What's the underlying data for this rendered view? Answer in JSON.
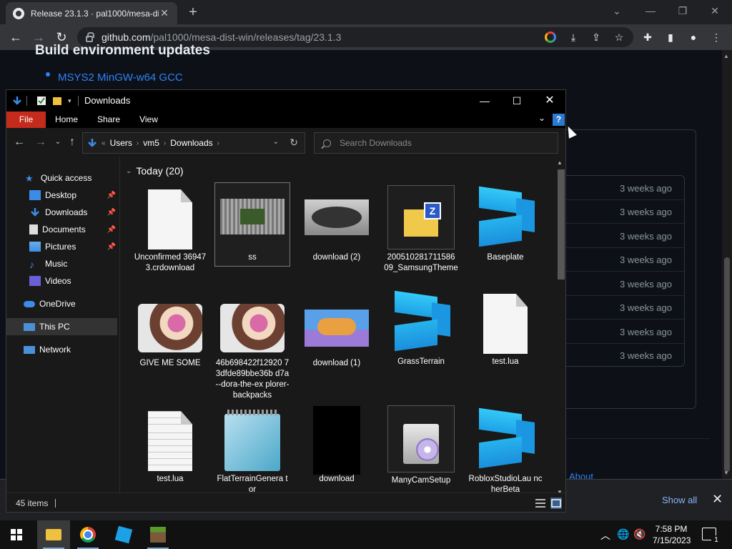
{
  "browser": {
    "tab_title": "Release 23.1.3 · pal1000/mesa-dis",
    "url_host": "github.com",
    "url_path": "/pal1000/mesa-dist-win/releases/tag/23.1.3",
    "download_bar": {
      "show_all": "Show all"
    }
  },
  "github_page": {
    "heading": "Build environment updates",
    "bullet_link": "MSYS2 MinGW-w64 GCC",
    "asset_dates": [
      "3 weeks ago",
      "3 weeks ago",
      "3 weeks ago",
      "3 weeks ago",
      "3 weeks ago",
      "3 weeks ago",
      "3 weeks ago",
      "3 weeks ago"
    ],
    "about_link": "About"
  },
  "explorer": {
    "window_title": "Downloads",
    "ribbon_tabs": [
      "File",
      "Home",
      "Share",
      "View"
    ],
    "ribbon_help": "?",
    "breadcrumb": [
      "Users",
      "vm5",
      "Downloads"
    ],
    "breadcrumb_lead": "«",
    "search_placeholder": "Search Downloads",
    "nav_pane": [
      {
        "label": "Quick access",
        "icon": "star-icon"
      },
      {
        "label": "Desktop",
        "icon": "desktop-icon",
        "pinned": true
      },
      {
        "label": "Downloads",
        "icon": "download-arrow-icon",
        "pinned": true
      },
      {
        "label": "Documents",
        "icon": "documents-icon",
        "pinned": true
      },
      {
        "label": "Pictures",
        "icon": "pictures-icon",
        "pinned": true
      },
      {
        "label": "Music",
        "icon": "music-note-icon"
      },
      {
        "label": "Videos",
        "icon": "videos-icon"
      },
      {
        "label": "OneDrive",
        "icon": "cloud-icon"
      },
      {
        "label": "This PC",
        "icon": "computer-icon"
      },
      {
        "label": "Network",
        "icon": "network-icon"
      }
    ],
    "group_header": "Today (20)",
    "files": [
      {
        "label": "Unconfirmed 369473.crdownload",
        "kind": "blank-document"
      },
      {
        "label": "ss",
        "kind": "image-tunnel"
      },
      {
        "label": "download (2)",
        "kind": "image-cat"
      },
      {
        "label": "200510281711586 09_SamsungTheme",
        "kind": "zip-folder"
      },
      {
        "label": "Baseplate",
        "kind": "roblox-studio"
      },
      {
        "label": "GIVE ME SOME",
        "kind": "image-dora"
      },
      {
        "label": "46b698422f12920 73dfde89bbe36b d7a--dora-the-ex plorer-backpacks",
        "kind": "image-dora"
      },
      {
        "label": "download (1)",
        "kind": "image-team-umizoomi"
      },
      {
        "label": "GrassTerrain",
        "kind": "roblox-studio"
      },
      {
        "label": "test.lua",
        "kind": "blank-document"
      },
      {
        "label": "test.lua",
        "kind": "text-document"
      },
      {
        "label": "FlatTerrainGenera tor",
        "kind": "notepad"
      },
      {
        "label": "download",
        "kind": "image-black"
      },
      {
        "label": "ManyCamSetup",
        "kind": "installer"
      },
      {
        "label": "RobloxStudioLau ncherBeta",
        "kind": "roblox-studio"
      }
    ],
    "status_count": "45 items"
  },
  "taskbar": {
    "apps": [
      "start-button",
      "file-explorer",
      "chrome",
      "roblox-studio",
      "minecraft"
    ],
    "clock_time": "7:58 PM",
    "clock_date": "7/15/2023",
    "notification_count": "1"
  },
  "colors": {
    "accent_file_tab": "#c42b1c",
    "link_blue": "#2f81f7",
    "explorer_bg": "#191919"
  }
}
